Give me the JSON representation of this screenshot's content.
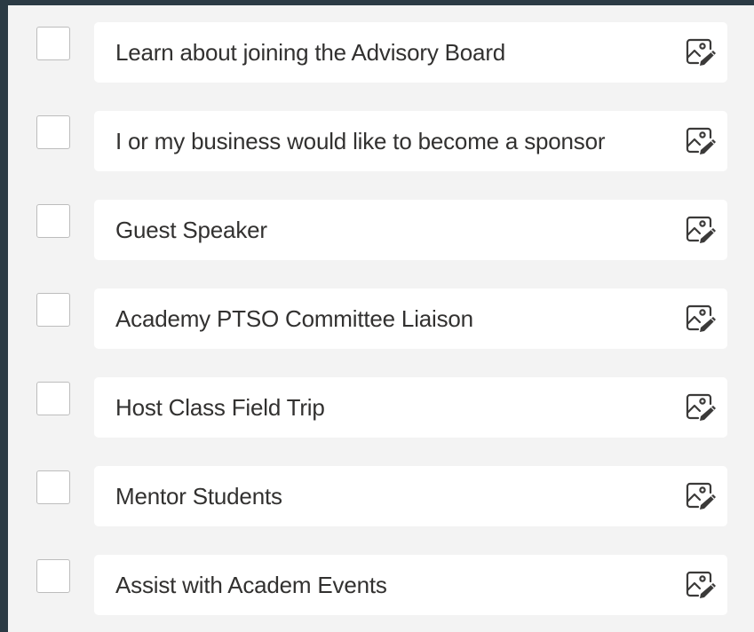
{
  "options": [
    {
      "label": "Learn about joining the Advisory Board",
      "checked": false
    },
    {
      "label": "I or my business would like to become a sponsor",
      "checked": false
    },
    {
      "label": "Guest Speaker",
      "checked": false
    },
    {
      "label": "Academy PTSO Committee Liaison",
      "checked": false
    },
    {
      "label": "Host Class Field Trip",
      "checked": false
    },
    {
      "label": "Mentor Students",
      "checked": false
    },
    {
      "label": "Assist with Academ Events",
      "checked": false
    }
  ],
  "icons": {
    "add_image": "insert-image-icon"
  },
  "colors": {
    "background": "#2b3a44",
    "panel": "#f3f3f3",
    "field": "#ffffff",
    "text": "#323130",
    "checkbox_border": "#bdbdbd"
  }
}
